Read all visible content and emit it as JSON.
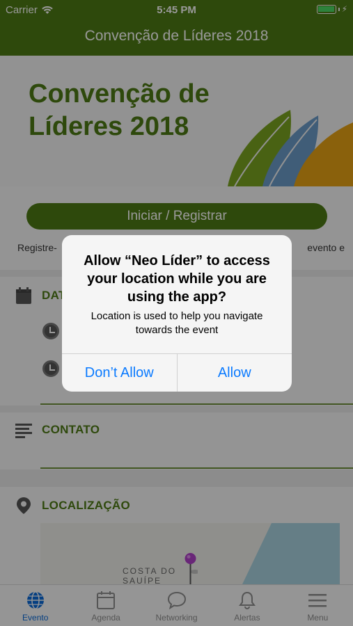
{
  "status_bar": {
    "carrier": "Carrier",
    "time": "5:45 PM"
  },
  "nav": {
    "title": "Convenção de Líderes 2018"
  },
  "hero": {
    "line1": "Convenção de",
    "line2": "Líderes 2018"
  },
  "main": {
    "primary_button": "Iniciar / Registrar",
    "register_left": "Registre-",
    "register_right": "evento e",
    "sections": {
      "dates": "DAT",
      "contact": "CONTATO",
      "location": "LOCALIZAÇÃO"
    },
    "map": {
      "label_line1": "COSTA DO",
      "label_line2": "SAUÍPE"
    }
  },
  "alert": {
    "title": "Allow “Neo Líder” to access your location while you are using the app?",
    "message": "Location is used to help you navigate towards the event",
    "deny_label": "Don’t Allow",
    "allow_label": "Allow"
  },
  "tabbar": {
    "items": [
      {
        "label": "Evento",
        "icon": "globe-icon",
        "active": true
      },
      {
        "label": "Agenda",
        "icon": "calendar-icon"
      },
      {
        "label": "Networking",
        "icon": "chat-bubble-icon"
      },
      {
        "label": "Alertas",
        "icon": "bell-icon"
      },
      {
        "label": "Menu",
        "icon": "hamburger-icon"
      }
    ]
  },
  "colors": {
    "brand_green": "#4e7a14",
    "ios_blue": "#0a7aff",
    "tab_active": "#0a6ad7"
  }
}
